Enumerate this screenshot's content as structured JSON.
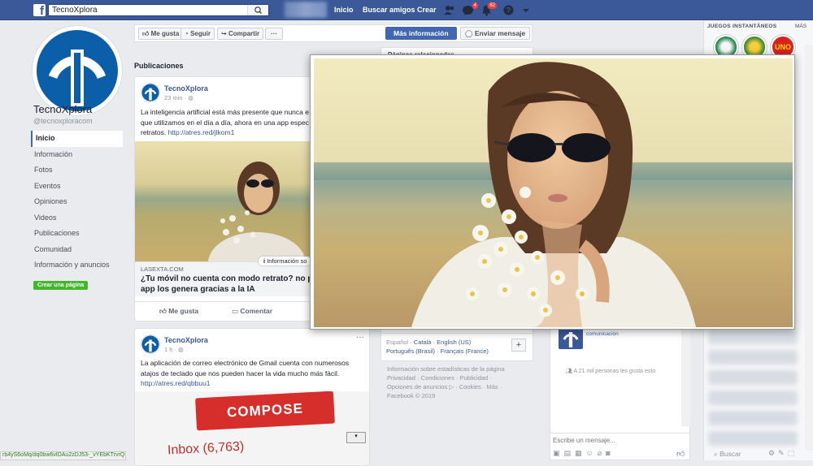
{
  "topbar": {
    "logo": "f",
    "search_value": "TecnoXplora",
    "nav_home": "Inicio",
    "nav_find_friends": "Buscar amigos",
    "nav_create": "Crear",
    "messages_count": "4",
    "notifications_count": "82"
  },
  "profile": {
    "name": "TecnoXplora",
    "handle": "@tecnoxploracom"
  },
  "left_nav": {
    "items": [
      "Inicio",
      "Información",
      "Fotos",
      "Eventos",
      "Opiniones",
      "Videos",
      "Publicaciones",
      "Comunidad",
      "Información y anuncios"
    ],
    "create_page": "Crear una página"
  },
  "status_url": "rb4yS6oMq/dq0bw6vIDAu2zDJ53-_vYEbKTrvrQ",
  "actions": {
    "like": "Me gusta",
    "follow": "Seguir",
    "share": "Compartir",
    "more": "···",
    "more_info": "Más información",
    "send_message": "Enviar mensaje"
  },
  "posts": {
    "heading": "Publicaciones",
    "post1": {
      "author": "TecnoXplora",
      "time": "23 min",
      "text_line1": "La inteligencia artificial está más presente que nunca e",
      "text_line2": "que utilizamos en el día a día, ahora en una app espec",
      "text_line3": "retratos.",
      "link": "http://atres.red/jlkom1",
      "source": "LASEXTA.COM",
      "info_tag": "Información so",
      "headline_line1": "¿Tu móvil no cuenta con modo retrato? no p",
      "headline_line2": "app los genera gracias a la IA",
      "like": "Me gusta",
      "comment": "Comentar"
    },
    "post2": {
      "author": "TecnoXplora",
      "time": "1 h",
      "text_line1": "La aplicación de correo electrónico de Gmail cuenta con numerosos",
      "text_line2": "atajos de teclado que nos pueden hacer la vida mucho más fácil.",
      "link": "http://atres.red/qbbuu1",
      "compose": "COMPOSE",
      "inbox": "Inbox (6,763)"
    }
  },
  "right_panel": {
    "heading": "Páginas relacionadas"
  },
  "languages": {
    "line1": [
      "Español",
      "Català",
      "English (US)"
    ],
    "line2": [
      "Português (Brasil)",
      "Français (France)"
    ],
    "plus": "+"
  },
  "footer": {
    "line1": "Información sobre estadísticas de la página",
    "line2": "Privacidad · Condiciones · Publicidad ·",
    "line3": "Opciones de anuncios ▷ · Cookies · Más ·",
    "line4": "Facebook © 2019"
  },
  "chat": {
    "subtitle": "comunicación",
    "likes": "A 21 mil personas les gusta esto",
    "placeholder": "Escribe un mensaje..."
  },
  "games": {
    "title": "JUEGOS INSTANTÁNEOS",
    "more": "MÁS",
    "uno_label": "UNO"
  },
  "sidebar_search": "Buscar",
  "colors": {
    "brand": "#3b5998",
    "primary_button": "#4267b2",
    "create_green": "#42b72a",
    "badge_red": "#fa3e3e"
  }
}
